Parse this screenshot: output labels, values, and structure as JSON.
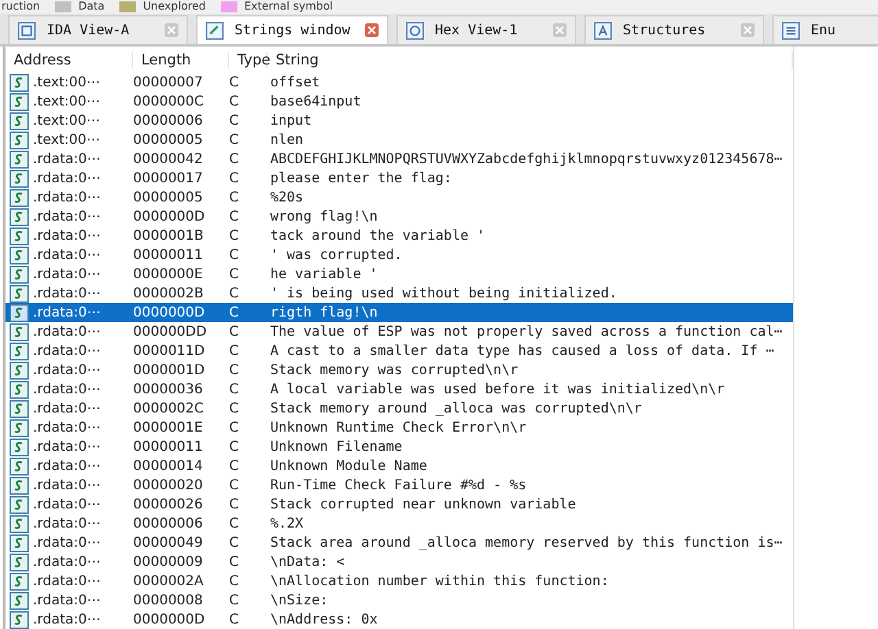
{
  "legend": [
    {
      "label": "ruction"
    },
    {
      "label": "Data",
      "color": "#c0c0c0"
    },
    {
      "label": "Unexplored",
      "color": "#b8b070"
    },
    {
      "label": "External symbol",
      "color": "#f0a0f0"
    }
  ],
  "tabs": [
    {
      "label": "IDA View-A",
      "kind": "view",
      "selected": false,
      "closable": true
    },
    {
      "label": "Strings window",
      "kind": "strings",
      "selected": true,
      "closable": true
    },
    {
      "label": "Hex View-1",
      "kind": "hex",
      "selected": false,
      "closable": true
    },
    {
      "label": "Structures",
      "kind": "structures",
      "selected": false,
      "closable": true
    },
    {
      "label": "Enu",
      "kind": "enums",
      "selected": false,
      "closable": false
    }
  ],
  "table": {
    "columns": [
      "Address",
      "Length",
      "Type",
      "String"
    ],
    "rows": [
      {
        "address": ".text:00⋯",
        "length": "00000007",
        "type": "C",
        "string": "offset",
        "selected": false
      },
      {
        "address": ".text:00⋯",
        "length": "0000000C",
        "type": "C",
        "string": "base64input",
        "selected": false
      },
      {
        "address": ".text:00⋯",
        "length": "00000006",
        "type": "C",
        "string": "input",
        "selected": false
      },
      {
        "address": ".text:00⋯",
        "length": "00000005",
        "type": "C",
        "string": "nlen",
        "selected": false
      },
      {
        "address": ".rdata:0⋯",
        "length": "00000042",
        "type": "C",
        "string": "ABCDEFGHIJKLMNOPQRSTUVWXYZabcdefghijklmnopqrstuvwxyz012345678⋯",
        "selected": false
      },
      {
        "address": ".rdata:0⋯",
        "length": "00000017",
        "type": "C",
        "string": "please enter the flag:",
        "selected": false
      },
      {
        "address": ".rdata:0⋯",
        "length": "00000005",
        "type": "C",
        "string": "%20s",
        "selected": false
      },
      {
        "address": ".rdata:0⋯",
        "length": "0000000D",
        "type": "C",
        "string": "wrong flag!\\n",
        "selected": false
      },
      {
        "address": ".rdata:0⋯",
        "length": "0000001B",
        "type": "C",
        "string": "tack around the variable '",
        "selected": false
      },
      {
        "address": ".rdata:0⋯",
        "length": "00000011",
        "type": "C",
        "string": "' was corrupted.",
        "selected": false
      },
      {
        "address": ".rdata:0⋯",
        "length": "0000000E",
        "type": "C",
        "string": "he variable '",
        "selected": false
      },
      {
        "address": ".rdata:0⋯",
        "length": "0000002B",
        "type": "C",
        "string": "' is being used without being initialized.",
        "selected": false
      },
      {
        "address": ".rdata:0⋯",
        "length": "0000000D",
        "type": "C",
        "string": "rigth flag!\\n",
        "selected": true
      },
      {
        "address": ".rdata:0⋯",
        "length": "000000DD",
        "type": "C",
        "string": "The value of ESP was not properly saved across a function cal⋯",
        "selected": false
      },
      {
        "address": ".rdata:0⋯",
        "length": "0000011D",
        "type": "C",
        "string": "A cast to a smaller data type has caused a loss of data.  If ⋯",
        "selected": false
      },
      {
        "address": ".rdata:0⋯",
        "length": "0000001D",
        "type": "C",
        "string": "Stack memory was corrupted\\n\\r",
        "selected": false
      },
      {
        "address": ".rdata:0⋯",
        "length": "00000036",
        "type": "C",
        "string": "A local variable was used before it was initialized\\n\\r",
        "selected": false
      },
      {
        "address": ".rdata:0⋯",
        "length": "0000002C",
        "type": "C",
        "string": "Stack memory around _alloca was corrupted\\n\\r",
        "selected": false
      },
      {
        "address": ".rdata:0⋯",
        "length": "0000001E",
        "type": "C",
        "string": "Unknown Runtime Check Error\\n\\r",
        "selected": false
      },
      {
        "address": ".rdata:0⋯",
        "length": "00000011",
        "type": "C",
        "string": "Unknown Filename",
        "selected": false
      },
      {
        "address": ".rdata:0⋯",
        "length": "00000014",
        "type": "C",
        "string": "Unknown Module Name",
        "selected": false
      },
      {
        "address": ".rdata:0⋯",
        "length": "00000020",
        "type": "C",
        "string": "Run-Time Check Failure #%d - %s",
        "selected": false
      },
      {
        "address": ".rdata:0⋯",
        "length": "00000026",
        "type": "C",
        "string": "Stack corrupted near unknown variable",
        "selected": false
      },
      {
        "address": ".rdata:0⋯",
        "length": "00000006",
        "type": "C",
        "string": "%.2X",
        "selected": false
      },
      {
        "address": ".rdata:0⋯",
        "length": "00000049",
        "type": "C",
        "string": "Stack area around _alloca memory reserved by this function is⋯",
        "selected": false
      },
      {
        "address": ".rdata:0⋯",
        "length": "00000009",
        "type": "C",
        "string": "\\nData: <",
        "selected": false
      },
      {
        "address": ".rdata:0⋯",
        "length": "0000002A",
        "type": "C",
        "string": "\\nAllocation number within this function:",
        "selected": false
      },
      {
        "address": ".rdata:0⋯",
        "length": "00000008",
        "type": "C",
        "string": "\\nSize:",
        "selected": false
      },
      {
        "address": ".rdata:0⋯",
        "length": "0000000D",
        "type": "C",
        "string": "\\nAddress: 0x",
        "selected": false
      }
    ]
  }
}
